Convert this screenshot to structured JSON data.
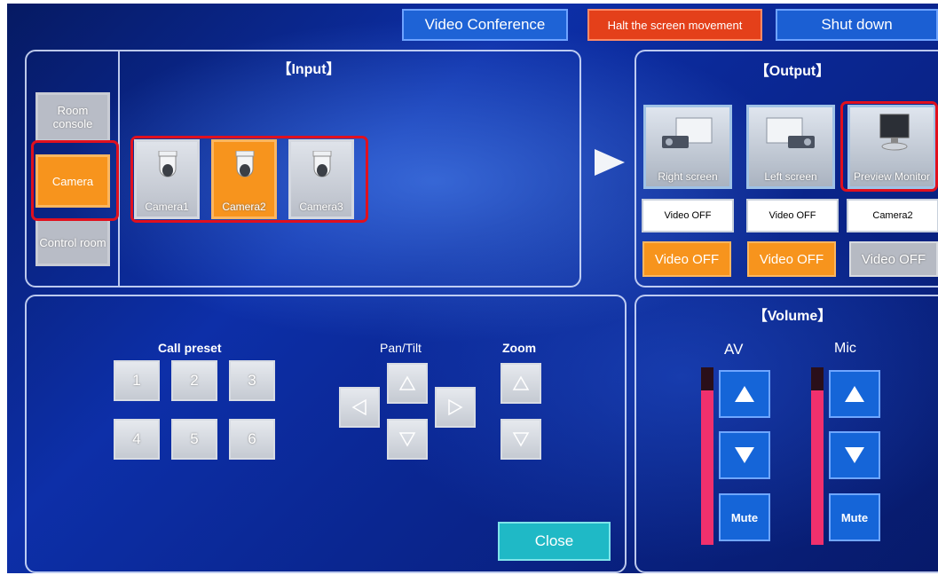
{
  "top_bar": {
    "video_conference": "Video Conference",
    "halt": "Halt the screen movement",
    "shutdown": "Shut down",
    "colors": {
      "video_conference": "#1e63d6",
      "halt": "#e4401a",
      "shutdown": "#1b5fd3"
    }
  },
  "input": {
    "title": "【Input】",
    "sources": [
      {
        "label": "Room console",
        "active": false
      },
      {
        "label": "Camera",
        "active": true
      },
      {
        "label": "Control room",
        "active": false
      }
    ],
    "cameras": [
      {
        "label": "Camera1",
        "active": false,
        "icon": "ptz-camera-icon"
      },
      {
        "label": "Camera2",
        "active": true,
        "icon": "ptz-camera-icon"
      },
      {
        "label": "Camera3",
        "active": false,
        "icon": "ptz-camera-icon"
      }
    ]
  },
  "output": {
    "title": "【Output】",
    "screens": [
      {
        "label": "Right screen",
        "status": "Video OFF",
        "button": "Video OFF",
        "icon": "projector-icon"
      },
      {
        "label": "Left screen",
        "status": "Video OFF",
        "button": "Video OFF",
        "icon": "projector-icon"
      },
      {
        "label": "Preview Monitor",
        "status": "Camera2",
        "button": "Video OFF",
        "icon": "monitor-icon"
      }
    ]
  },
  "camera_control": {
    "call_preset_label": "Call preset",
    "presets": [
      "1",
      "2",
      "3",
      "4",
      "5",
      "6"
    ],
    "pan_tilt_label": "Pan/Tilt",
    "zoom_label": "Zoom",
    "close_label": "Close"
  },
  "volume": {
    "title": "【Volume】",
    "channels": [
      {
        "label": "AV",
        "mute_label": "Mute",
        "level": 0.87
      },
      {
        "label": "Mic",
        "mute_label": "Mute",
        "level": 0.87
      }
    ]
  },
  "colors": {
    "accent_orange": "#f7941d",
    "highlight_red": "#e0101e",
    "close_teal": "#1fb9c6",
    "level_pink": "#f0306d"
  }
}
